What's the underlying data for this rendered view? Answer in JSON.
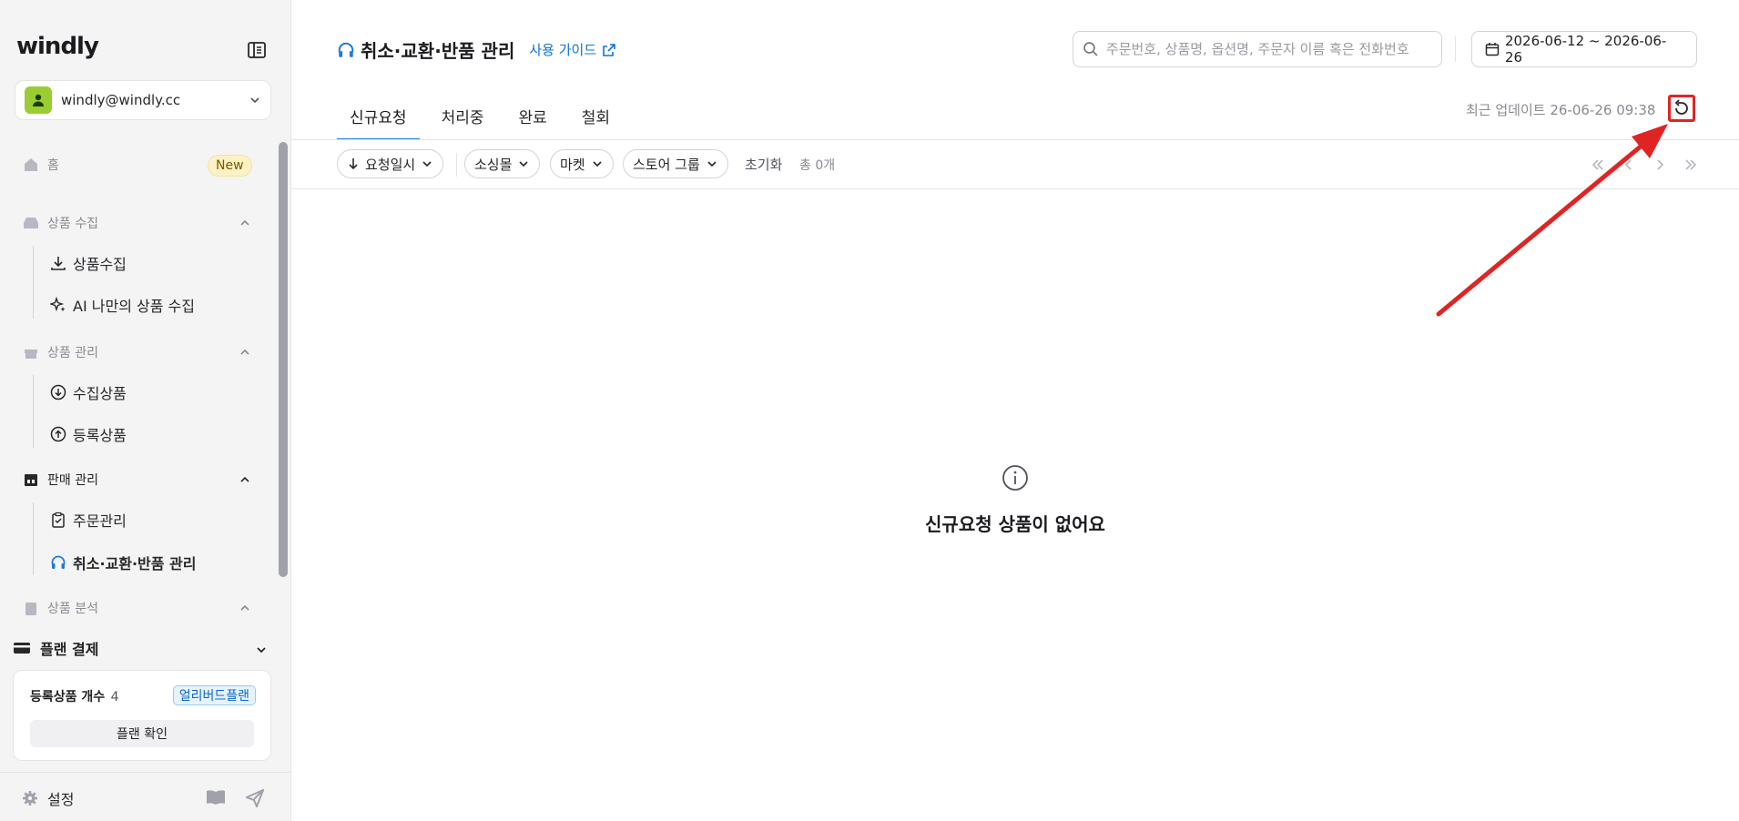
{
  "app": {
    "logo": "windly"
  },
  "account": {
    "email": "windly@windly.cc"
  },
  "sidebar": {
    "home": {
      "label": "홈",
      "badge": "New"
    },
    "groups": [
      {
        "label": "상품 수집",
        "items": [
          "상품수집",
          "AI 나만의 상품 수집"
        ]
      },
      {
        "label": "상품 관리",
        "items": [
          "수집상품",
          "등록상품"
        ]
      },
      {
        "label": "판매 관리",
        "items": [
          "주문관리",
          "취소·교환·반품 관리"
        ]
      },
      {
        "label": "상품 분석",
        "items": []
      }
    ],
    "plan": {
      "header": "플랜 결제",
      "count_label": "등록상품 개수",
      "count_value": "4",
      "plan_name": "얼리버드플랜",
      "confirm_label": "플랜 확인"
    },
    "footer": {
      "settings_label": "설정"
    }
  },
  "header": {
    "title": "취소·교환·반품 관리",
    "guide_label": "사용 가이드",
    "search_placeholder": "주문번호, 상품명, 옵션명, 주문자 이름 혹은 전화번호",
    "date_range": "2026-06-12 ~ 2026-06-26"
  },
  "tabs": [
    {
      "label": "신규요청",
      "active": true
    },
    {
      "label": "처리중",
      "active": false
    },
    {
      "label": "완료",
      "active": false
    },
    {
      "label": "철회",
      "active": false
    }
  ],
  "last_update": "최근 업데이트 26-06-26 09:38",
  "filters": {
    "sort_label": "요청일시",
    "source_label": "소싱몰",
    "market_label": "마켓",
    "store_group_label": "스토어 그룹",
    "reset_label": "초기화",
    "total_label": "총 0개"
  },
  "empty_state": {
    "message": "신규요청 상품이 없어요"
  },
  "colors": {
    "accent": "#1f7ae0",
    "highlight": "#e02424",
    "avatar": "#9acd32"
  }
}
